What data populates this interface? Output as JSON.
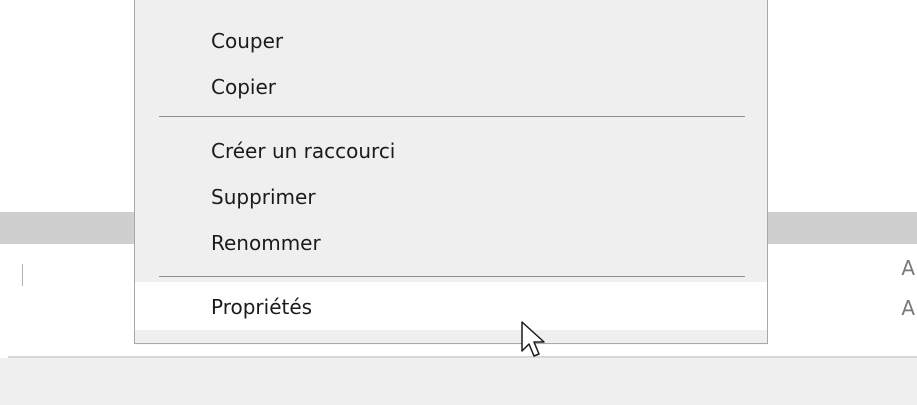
{
  "context_menu": {
    "items": [
      {
        "label": "Couper"
      },
      {
        "label": "Copier"
      },
      {
        "label": "Créer un raccourci"
      },
      {
        "label": "Supprimer"
      },
      {
        "label": "Renommer"
      },
      {
        "label": "Propriétés"
      }
    ]
  },
  "background": {
    "right_peek_1": "A",
    "right_peek_2": "A"
  },
  "pointer": {
    "icon": "mouse-pointer-icon"
  },
  "colors": {
    "menu_background": "#efefef",
    "menu_border": "#a7a7a7",
    "highlight": "#ffffff",
    "band": "#cfcfcf",
    "footer": "#f0f0f0"
  }
}
